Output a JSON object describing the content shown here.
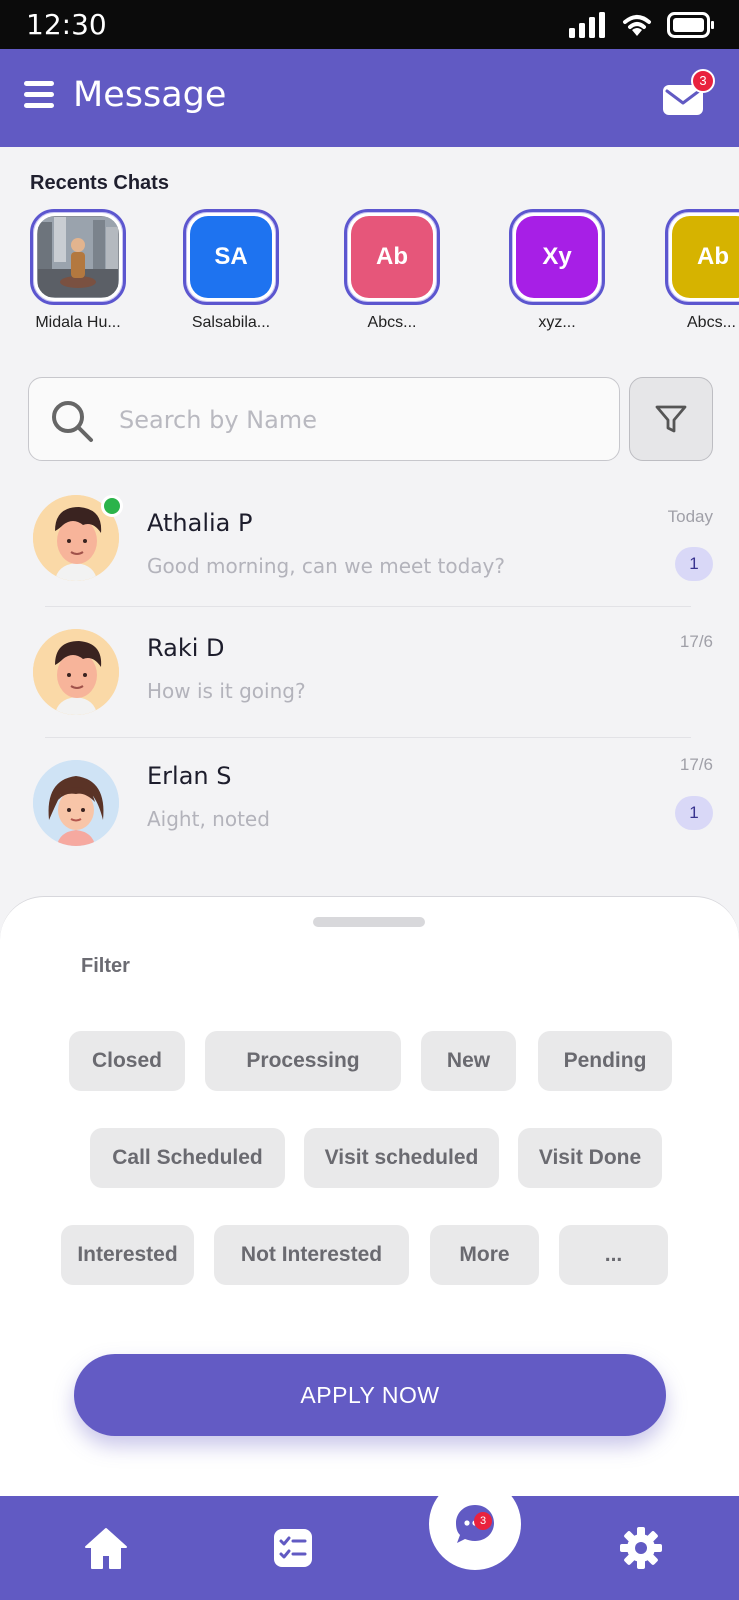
{
  "status_bar": {
    "time": "12:30"
  },
  "app_bar": {
    "title": "Message",
    "mail_badge": "3"
  },
  "recents": {
    "title": "Recents Chats",
    "items": [
      {
        "name": "Midala Hu...",
        "initials": "",
        "color": "photo"
      },
      {
        "name": "Salsabila...",
        "initials": "SA",
        "color": "#1e73f0"
      },
      {
        "name": "Abcs...",
        "initials": "Ab",
        "color": "#e6567a"
      },
      {
        "name": "xyz...",
        "initials": "Xy",
        "color": "#a71fe6"
      },
      {
        "name": "Abcs...",
        "initials": "Ab",
        "color": "#d6b300"
      }
    ]
  },
  "search": {
    "placeholder": "Search by Name",
    "value": ""
  },
  "chats": [
    {
      "name": "Athalia P",
      "message": "Good morning, can we meet today?",
      "time": "Today",
      "unread": "1",
      "online": true
    },
    {
      "name": "Raki D",
      "message": "How is it going?",
      "time": "17/6",
      "unread": "",
      "online": false
    },
    {
      "name": "Erlan S",
      "message": "Aight, noted",
      "time": "17/6",
      "unread": "1",
      "online": false
    }
  ],
  "filter_sheet": {
    "title": "Filter",
    "chips": [
      "Closed",
      "Processing",
      "New",
      "Pending",
      "Call Scheduled",
      "Visit scheduled",
      "Visit Done",
      "Interested",
      "Not Interested",
      "More",
      "..."
    ],
    "apply_label": "APPLY NOW"
  },
  "bottom_nav": {
    "chat_badge": "3",
    "items": [
      "home-icon",
      "tasks-icon",
      "chat-icon",
      "settings-icon"
    ]
  },
  "colors": {
    "primary": "#615ac3",
    "badge": "#e9223e",
    "online": "#2bb34a"
  }
}
